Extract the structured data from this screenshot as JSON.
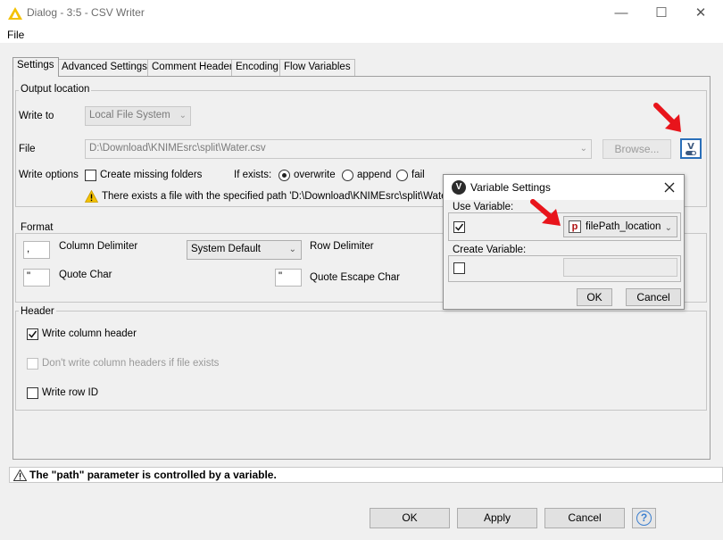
{
  "window": {
    "title": "Dialog - 3:5 - CSV Writer",
    "menu_file": "File",
    "minimize": "—",
    "maximize": "☐",
    "close": "✕"
  },
  "tabs": [
    "Settings",
    "Advanced Settings",
    "Comment Header",
    "Encoding",
    "Flow Variables"
  ],
  "output_location": {
    "group_title": "Output location",
    "write_to_label": "Write to",
    "write_to_value": "Local File System",
    "file_label": "File",
    "file_value": "D:\\Download\\KNIMEsrc\\split\\Water.csv",
    "browse_label": "Browse...",
    "write_options_label": "Write options",
    "create_missing_folders": "Create missing folders",
    "if_exists_label": "If exists:",
    "radio_overwrite": "overwrite",
    "radio_append": "append",
    "radio_fail": "fail",
    "warning_text": "There exists a file with the specified path 'D:\\Download\\KNIMEsrc\\split\\Water.cs",
    "variable_button": "V"
  },
  "format": {
    "group_title": "Format",
    "column_delimiter_value": ",",
    "column_delimiter_label": "Column Delimiter",
    "row_delimiter_value": "System Default",
    "row_delimiter_label": "Row Delimiter",
    "quote_char_value": "\"",
    "quote_char_label": "Quote Char",
    "quote_escape_value": "\"",
    "quote_escape_label": "Quote Escape Char"
  },
  "header": {
    "group_title": "Header",
    "write_column_header": "Write column header",
    "write_column_header_checked": true,
    "dont_write_headers": "Don't write column headers if file exists",
    "write_row_id": "Write row ID"
  },
  "variable_settings": {
    "title": "Variable Settings",
    "badge": "V",
    "use_variable_label": "Use Variable:",
    "use_variable_checked": true,
    "variable_type_glyph": "p",
    "variable_name": "filePath_location",
    "create_variable_label": "Create Variable:",
    "create_variable_checked": false,
    "ok_label": "OK",
    "cancel_label": "Cancel"
  },
  "status": {
    "text": "The \"path\" parameter is controlled by a variable."
  },
  "footer": {
    "ok_label": "OK",
    "apply_label": "Apply",
    "cancel_label": "Cancel",
    "help_glyph": "?"
  },
  "colors": {
    "arrow_red": "#e8141b",
    "knime_yellow": "#f3c100",
    "help_blue": "#3b7fd0",
    "variable_button_bg": "#3d5a80"
  }
}
